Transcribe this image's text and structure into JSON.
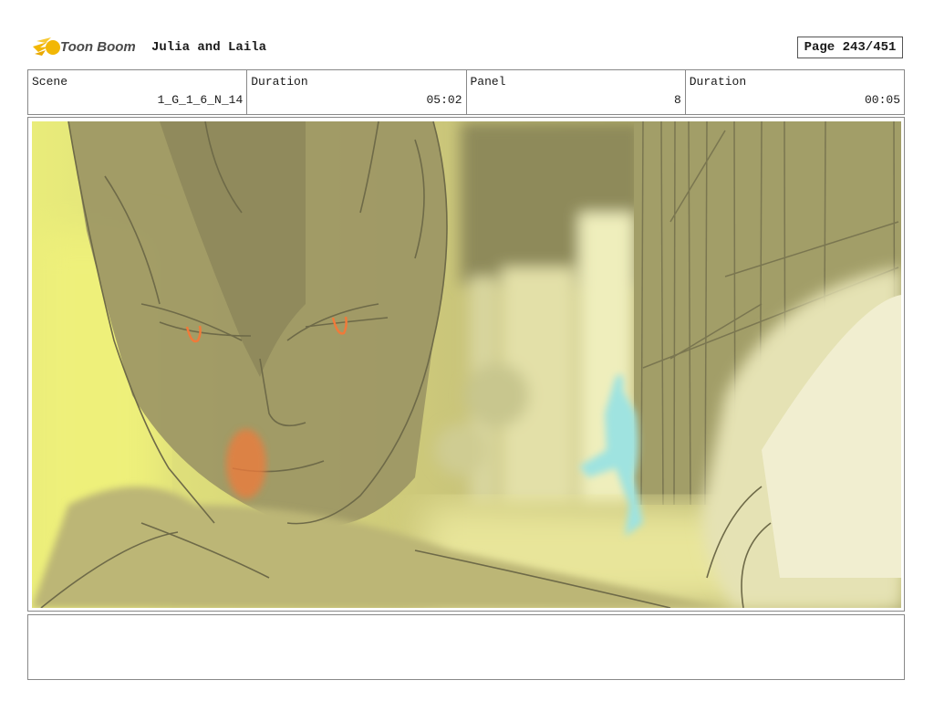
{
  "header": {
    "logo_text": "Toon Boom",
    "project_title": "Julia and Laila",
    "page_label": "Page 243/451"
  },
  "info": {
    "scene_label": "Scene",
    "scene_value": "1_G_1_6_N_14",
    "duration_label": "Duration",
    "duration_value": "05:02",
    "panel_label": "Panel",
    "panel_value": "8",
    "panel_duration_label": "Duration",
    "panel_duration_value": "00:05"
  },
  "colors": {
    "logo_accent": "#f2b705",
    "scene_wash": "#d9d77a",
    "accent_orange": "#f07a3a",
    "figure_cyan": "#9fe3e0"
  },
  "notes": ""
}
